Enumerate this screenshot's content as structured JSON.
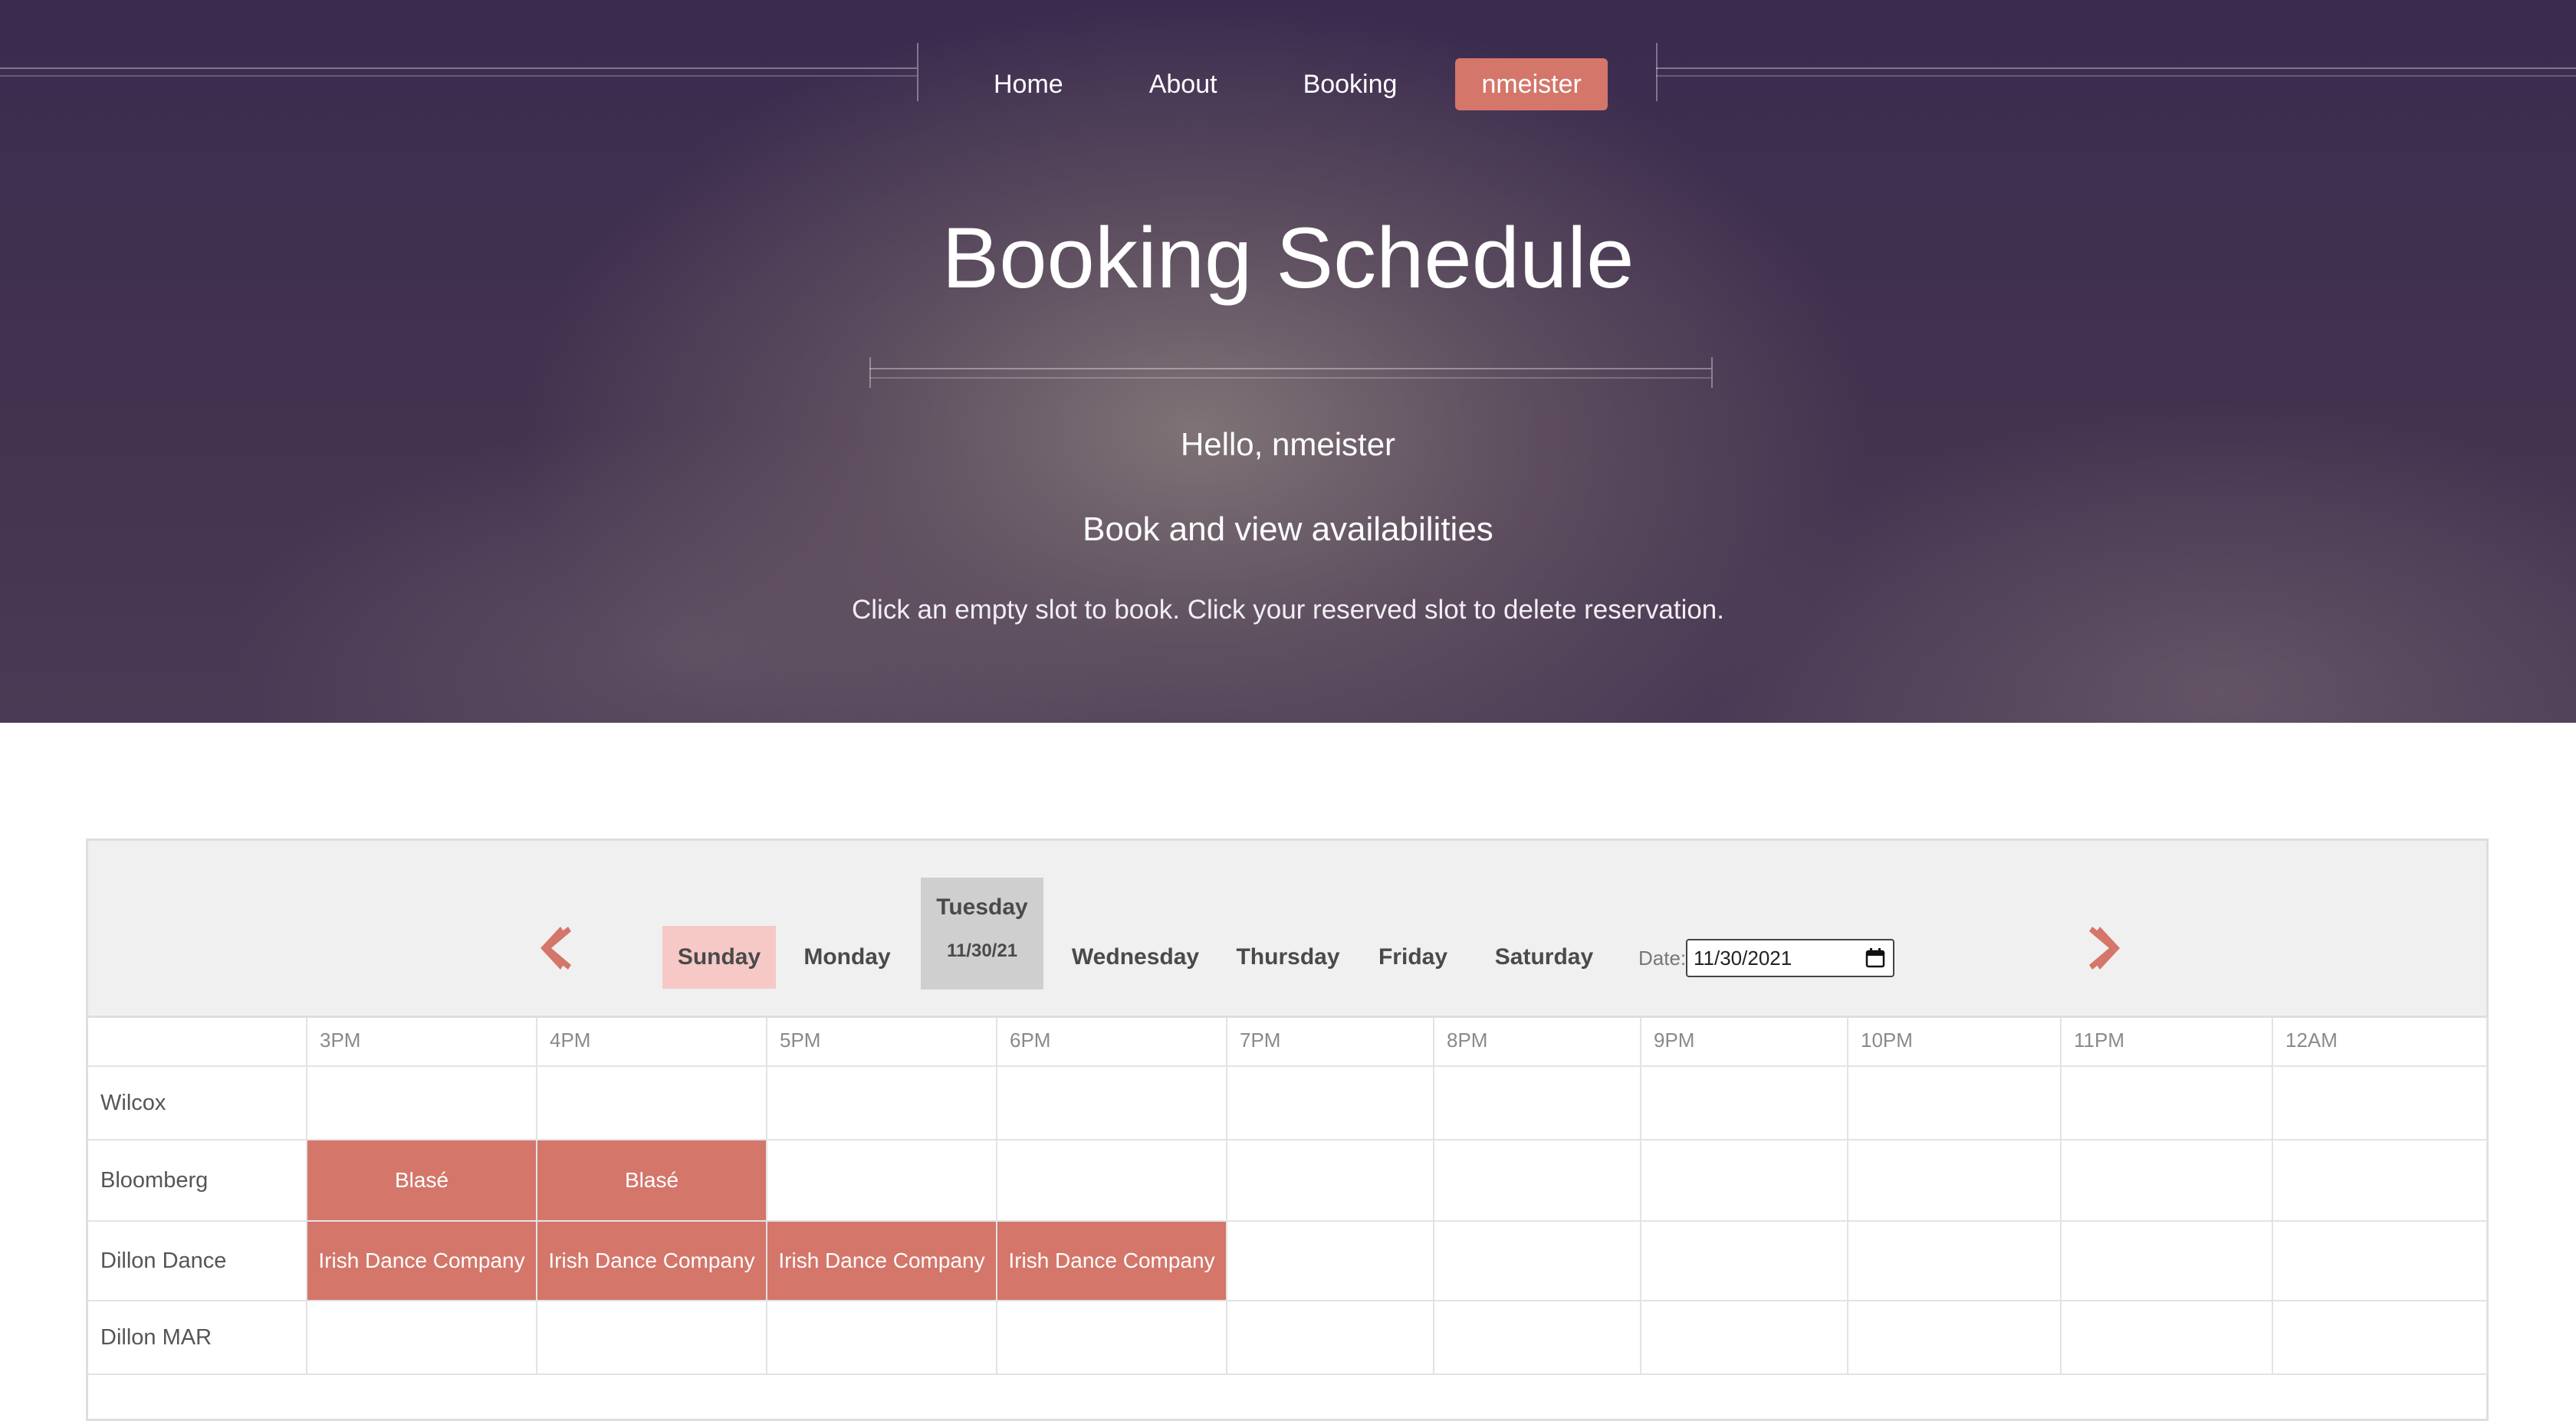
{
  "nav": {
    "items": [
      "Home",
      "About",
      "Booking"
    ],
    "user": "nmeister"
  },
  "hero": {
    "title": "Booking Schedule",
    "greeting": "Hello, nmeister",
    "subtitle": "Book and view availabilities",
    "instructions": "Click an empty slot to book. Click your reserved slot to delete reservation."
  },
  "schedule": {
    "days": [
      "Sunday",
      "Monday",
      "Tuesday",
      "Wednesday",
      "Thursday",
      "Friday",
      "Saturday"
    ],
    "selected_day": "Tuesday",
    "selected_day_date": "11/30/21",
    "date_label": "Date:",
    "date_value": "11/30/2021",
    "times": [
      "3PM",
      "4PM",
      "5PM",
      "6PM",
      "7PM",
      "8PM",
      "9PM",
      "10PM",
      "11PM",
      "12AM"
    ],
    "rooms": [
      {
        "name": "Wilcox",
        "slots": [
          "",
          "",
          "",
          "",
          "",
          "",
          "",
          "",
          "",
          ""
        ]
      },
      {
        "name": "Bloomberg",
        "slots": [
          "Blasé",
          "Blasé",
          "",
          "",
          "",
          "",
          "",
          "",
          "",
          ""
        ]
      },
      {
        "name": "Dillon Dance",
        "slots": [
          "Irish Dance Company",
          "Irish Dance Company",
          "Irish Dance Company",
          "Irish Dance Company",
          "",
          "",
          "",
          "",
          "",
          ""
        ]
      },
      {
        "name": "Dillon MAR",
        "slots": [
          "",
          "",
          "",
          "",
          "",
          "",
          "",
          "",
          "",
          ""
        ]
      }
    ]
  },
  "colors": {
    "accent": "#d4766a",
    "sunday_highlight": "#f6c9c7",
    "today_highlight": "#cfcfcf",
    "hero_bg": "#3a2b4f"
  },
  "icons": {
    "prev": "chevron-left-icon",
    "next": "chevron-right-icon",
    "calendar": "calendar-icon"
  }
}
